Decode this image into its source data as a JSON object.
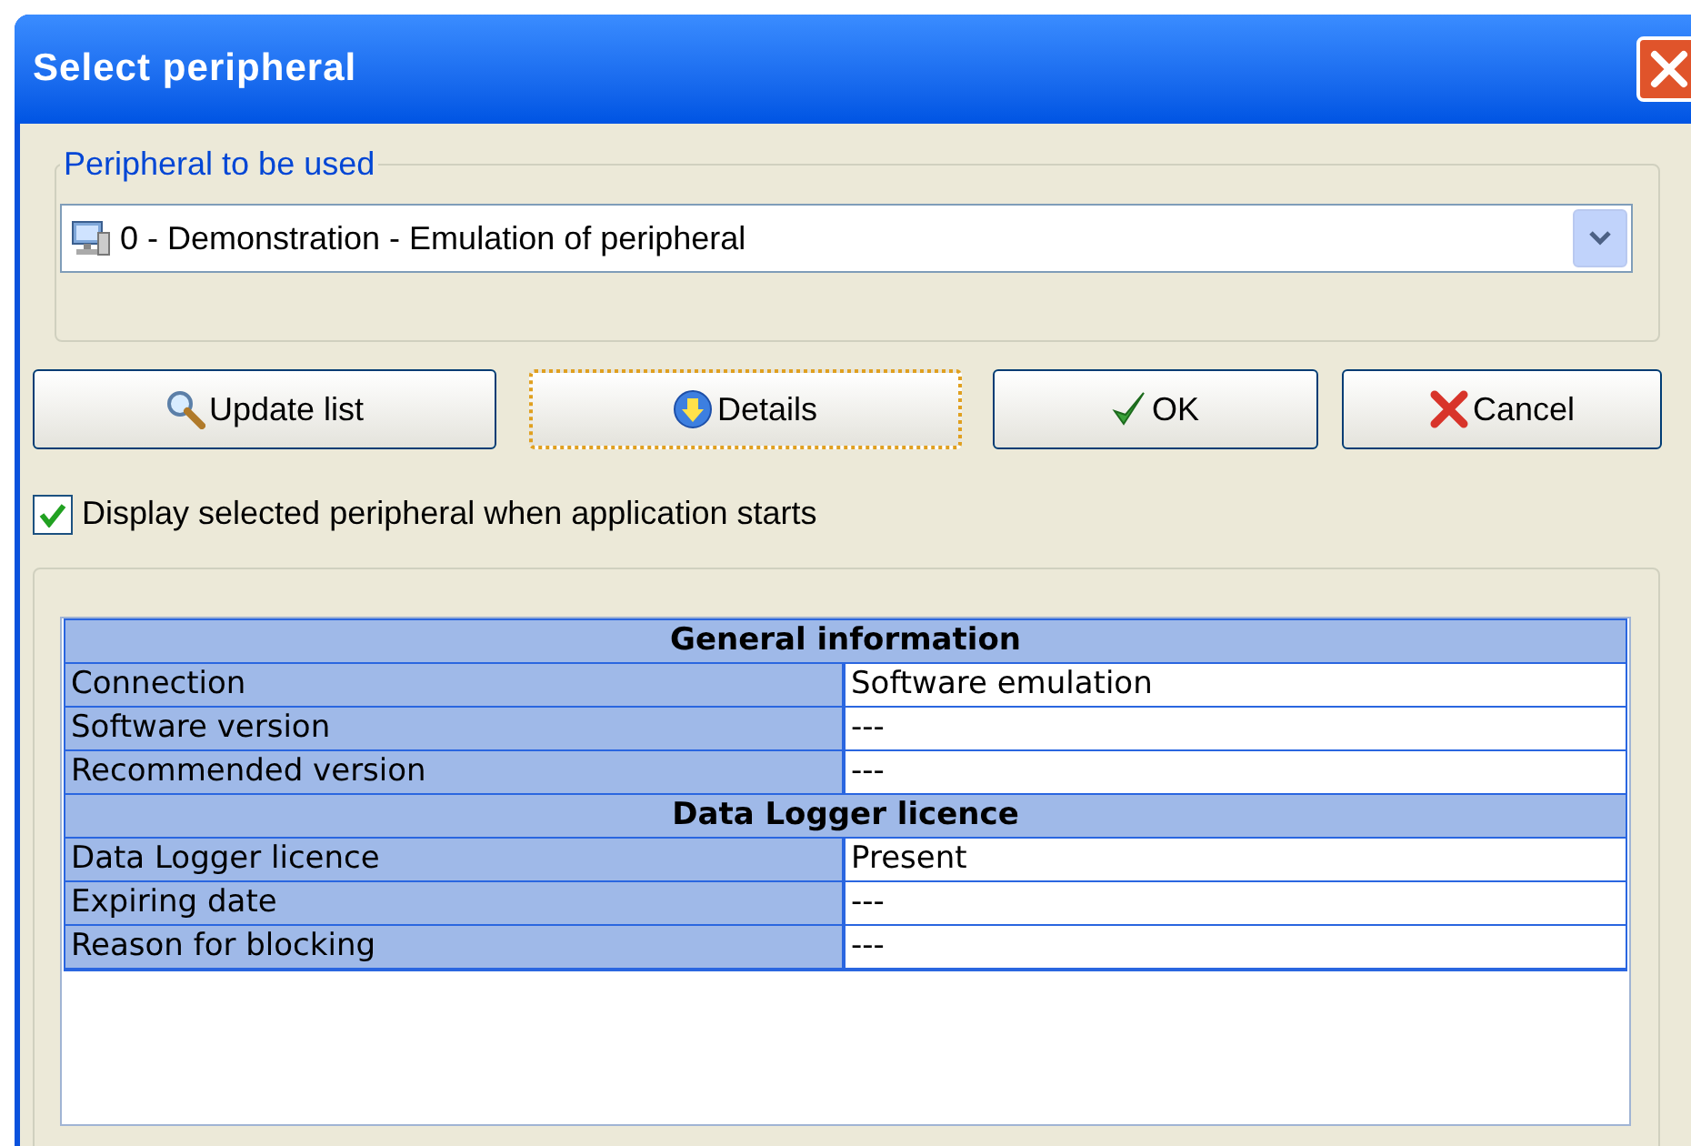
{
  "window": {
    "title": "Select peripheral"
  },
  "peripheral_group": {
    "legend": "Peripheral to be used",
    "selected_value": "0 - Demonstration - Emulation of peripheral"
  },
  "buttons": [
    {
      "label": "Update list",
      "kind": "search",
      "focused": false
    },
    {
      "label": "Details",
      "kind": "details",
      "focused": true
    },
    {
      "label": "OK",
      "kind": "ok",
      "focused": false
    },
    {
      "label": "Cancel",
      "kind": "cancel",
      "focused": false
    }
  ],
  "startup_checkbox": {
    "label": "Display selected peripheral when application starts",
    "checked": true
  },
  "info_table": {
    "sections": [
      {
        "title": "General information",
        "rows": [
          {
            "label": "Connection",
            "value": "Software emulation"
          },
          {
            "label": "Software version",
            "value": "---"
          },
          {
            "label": "Recommended version",
            "value": "---"
          }
        ]
      },
      {
        "title": "Data Logger licence",
        "rows": [
          {
            "label": "Data Logger licence",
            "value": "Present"
          },
          {
            "label": "Expiring date",
            "value": "---"
          },
          {
            "label": "Reason for blocking",
            "value": "---"
          }
        ]
      }
    ]
  }
}
